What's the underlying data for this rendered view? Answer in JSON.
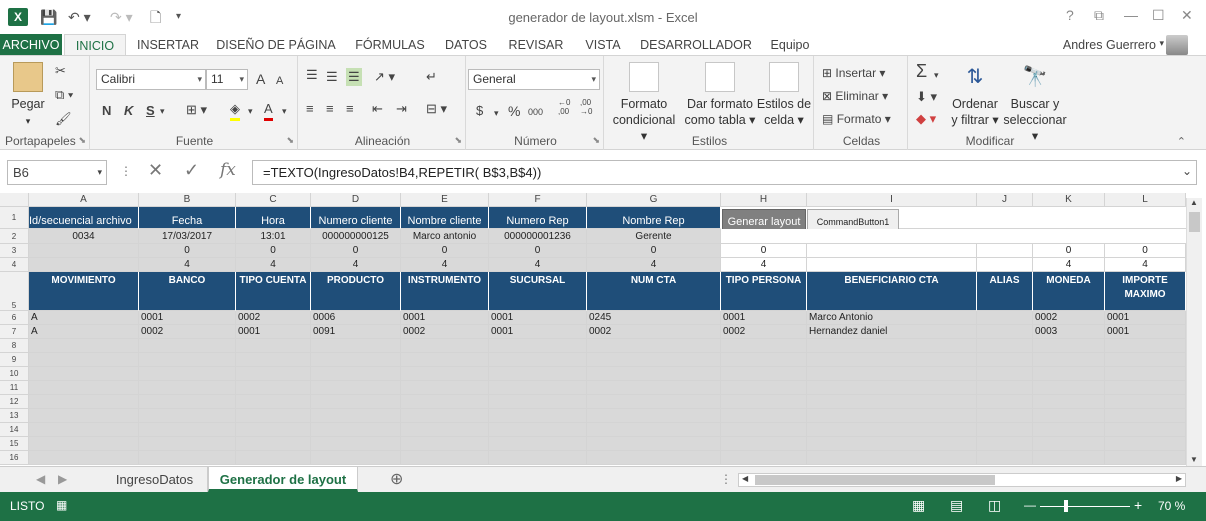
{
  "window": {
    "title": "generador de layout.xlsm - Excel",
    "help": "?"
  },
  "tabs": {
    "file": "ARCHIVO",
    "items": [
      "INICIO",
      "INSERTAR",
      "DISEÑO DE PÁGINA",
      "FÓRMULAS",
      "DATOS",
      "REVISAR",
      "VISTA",
      "DESARROLLADOR",
      "Equipo"
    ]
  },
  "user": {
    "name": "Andres Guerrero"
  },
  "ribbon": {
    "clipboard": {
      "label": "Portapapeles",
      "paste": "Pegar"
    },
    "font": {
      "label": "Fuente",
      "name": "Calibri",
      "size": "11",
      "bold": "N",
      "italic": "K",
      "underline": "S",
      "grow": "A",
      "shrink": "A",
      "color": "A"
    },
    "alignment": {
      "label": "Alineación"
    },
    "number": {
      "label": "Número",
      "format": "General",
      "currency": "$",
      "percent": "%",
      "thousands": "000",
      "inc_dec": "←0 ,00",
      "dec_dec": ",00 →0"
    },
    "styles": {
      "label": "Estilos",
      "conditional": "Formato condicional",
      "table": "Dar formato como tabla",
      "cell": "Estilos de celda"
    },
    "cells": {
      "label": "Celdas",
      "insert": "Insertar",
      "delete": "Eliminar",
      "format": "Formato"
    },
    "edit": {
      "label": "Modificar",
      "sum": "Σ",
      "sort": "Ordenar y filtrar",
      "find": "Buscar y seleccionar"
    }
  },
  "formula_bar": {
    "name_box": "B6",
    "formula": "=TEXTO(IngresoDatos!B4,REPETIR( B$3,B$4))",
    "fx": "fx",
    "cancel": "✕",
    "enter": "✓"
  },
  "columns": [
    "A",
    "B",
    "C",
    "D",
    "E",
    "F",
    "G",
    "H",
    "I",
    "J",
    "K",
    "L"
  ],
  "rows": [
    "1",
    "2",
    "3",
    "4",
    "5",
    "6",
    "7",
    "8",
    "9",
    "10",
    "11",
    "12",
    "13",
    "14",
    "15",
    "16"
  ],
  "row1": [
    "Id/secuencial archivo",
    "Fecha",
    "Hora",
    "Numero cliente",
    "Nombre cliente",
    "Numero Rep",
    "Nombre Rep"
  ],
  "row2": [
    "0034",
    "17/03/2017",
    "13:01",
    "000000000125",
    "Marco antonio",
    "000000001236",
    "Gerente"
  ],
  "row3": [
    "",
    "0",
    "0",
    "0",
    "0",
    "0",
    "0",
    "0",
    "",
    "",
    "0",
    "0"
  ],
  "row4": [
    "",
    "4",
    "4",
    "4",
    "4",
    "4",
    "4",
    "4",
    "",
    "",
    "4",
    "4"
  ],
  "row5": [
    "MOVIMIENTO",
    "BANCO",
    "TIPO CUENTA",
    "PRODUCTO",
    "INSTRUMENTO",
    "SUCURSAL",
    "NUM CTA",
    "TIPO PERSONA",
    "BENEFICIARIO CTA",
    "ALIAS",
    "MONEDA",
    "IMPORTE MAXIMO"
  ],
  "row6": [
    "A",
    "0001",
    "0002",
    "0006",
    "0001",
    "0001",
    "0245",
    "0001",
    "Marco Antonio",
    "",
    "0002",
    "0001"
  ],
  "row7": [
    "A",
    "0002",
    "0001",
    "0091",
    "0002",
    "0001",
    "0002",
    "0002",
    "Hernandez daniel",
    "",
    "0003",
    "0001"
  ],
  "buttons": {
    "generate": "Generar layout",
    "command": "CommandButton1"
  },
  "sheets": [
    "IngresoDatos",
    "Generador de layout"
  ],
  "status": {
    "ready": "LISTO",
    "zoom": "70 %"
  }
}
